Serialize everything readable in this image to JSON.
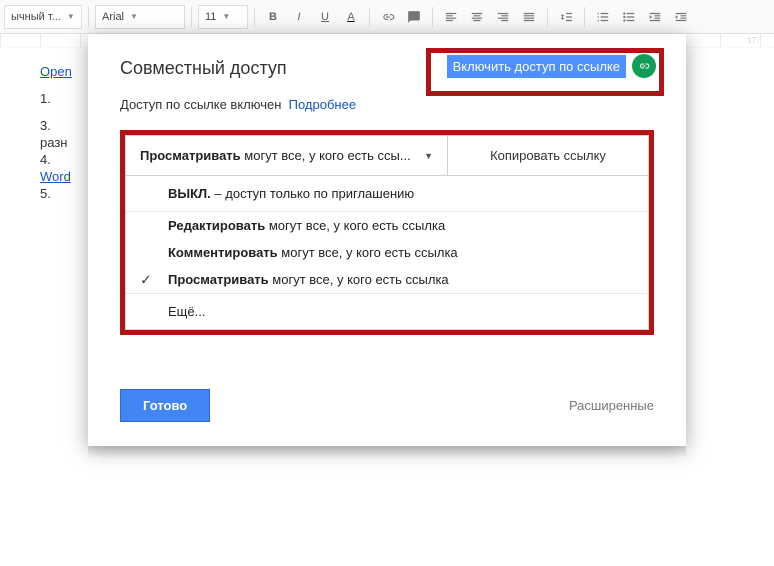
{
  "toolbar": {
    "style_label": "ычный т...",
    "font_label": "Arial",
    "size_label": "11"
  },
  "ruler": {
    "right_mark": "17"
  },
  "doc": {
    "l1": "Open",
    "l2": "1.",
    "l3": "3.",
    "l4": "разн",
    "l5": "4.",
    "l6": "Word",
    "l7": "5."
  },
  "dialog": {
    "title": "Совместный доступ",
    "enable_link": "Включить доступ по ссылке",
    "status_prefix": "Доступ по ссылке включен",
    "status_link": "Подробнее",
    "perm_selected_bold": "Просматривать",
    "perm_selected_rest": " могут все, у кого есть ссы...",
    "copy_label": "Копировать ссылку",
    "opts": {
      "off_bold": "ВЫКЛ.",
      "off_rest": " – доступ только по приглашению",
      "edit_bold": "Редактировать",
      "edit_rest": " могут все, у кого есть ссылка",
      "comment_bold": "Комментировать",
      "comment_rest": " могут все, у кого есть ссылка",
      "view_bold": "Просматривать",
      "view_rest": " могут все, у кого есть ссылка",
      "more": "Ещё..."
    },
    "done": "Готово",
    "advanced": "Расширенные"
  }
}
